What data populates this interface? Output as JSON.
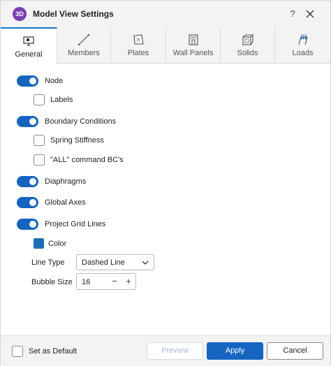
{
  "window": {
    "app_icon_text": "3D",
    "title": "Model View Settings",
    "help": "?"
  },
  "tabs": [
    {
      "label": "General",
      "icon": "monitor-icon",
      "active": true
    },
    {
      "label": "Members",
      "icon": "member-line-icon",
      "active": false
    },
    {
      "label": "Plates",
      "icon": "plate-icon",
      "active": false
    },
    {
      "label": "Wall Panels",
      "icon": "wall-panel-icon",
      "active": false
    },
    {
      "label": "Solids",
      "icon": "solid-cube-icon",
      "active": false
    },
    {
      "label": "Loads",
      "icon": "loads-icon",
      "active": false
    }
  ],
  "settings": {
    "node": {
      "label": "Node",
      "on": true
    },
    "labels": {
      "label": "Labels",
      "checked": false
    },
    "boundary": {
      "label": "Boundary Conditions",
      "on": true
    },
    "spring": {
      "label": "Spring Stiffness",
      "checked": false
    },
    "all_command": {
      "label": "\"ALL\" command BC's",
      "checked": false
    },
    "diaphragms": {
      "label": "Diaphragms",
      "on": true
    },
    "global_axes": {
      "label": "Global Axes",
      "on": true
    },
    "grid_lines": {
      "label": "Project Grid Lines",
      "on": true
    },
    "color": {
      "label": "Color",
      "value": "#1a6fb8"
    },
    "line_type": {
      "label": "Line Type",
      "value": "Dashed Line"
    },
    "bubble_size": {
      "label": "Bubble Size",
      "value": "16",
      "minus": "−",
      "plus": "+"
    }
  },
  "footer": {
    "set_default": {
      "label": "Set as Default",
      "checked": false
    },
    "preview": "Preview",
    "apply": "Apply",
    "cancel": "Cancel"
  },
  "colors": {
    "accent": "#1565c0",
    "app_icon": "#7a3fb0"
  }
}
